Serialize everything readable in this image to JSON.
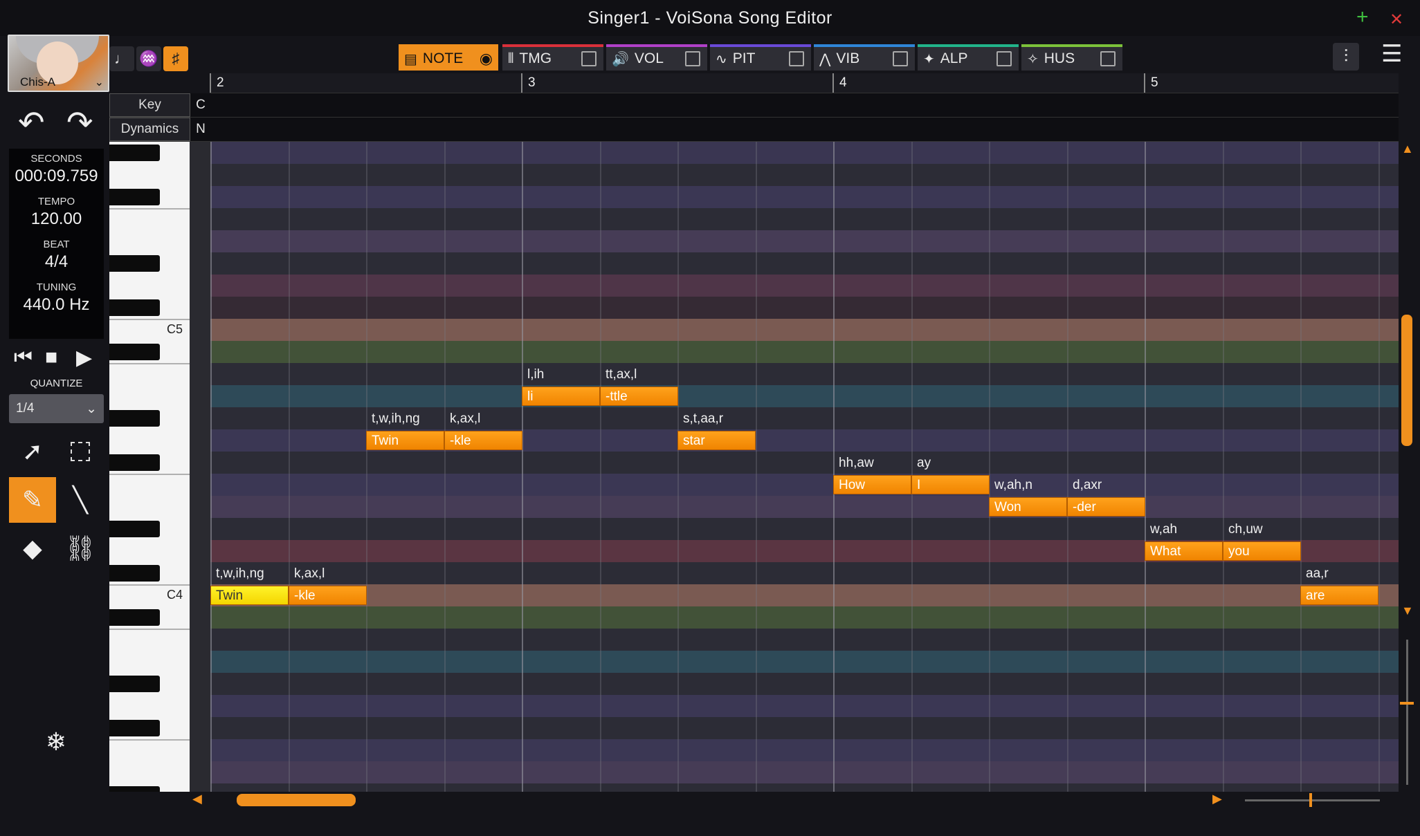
{
  "window": {
    "title": "Singer1 - VoiSona Song Editor",
    "add_symbol": "+",
    "close_symbol": "✕"
  },
  "singer": {
    "name": "Chis-A",
    "chevron": "⌄"
  },
  "info": {
    "seconds_label": "SECONDS",
    "seconds": "000:09.759",
    "tempo_label": "TEMPO",
    "tempo": "120.00",
    "beat_label": "BEAT",
    "beat": "4/4",
    "tuning_label": "TUNING",
    "tuning": "440.0 Hz"
  },
  "quantize": {
    "label": "QUANTIZE",
    "value": "1/4"
  },
  "tabs": [
    {
      "label": "NOTE",
      "color": "#f0901e"
    },
    {
      "label": "TMG",
      "color": "#d9303a"
    },
    {
      "label": "VOL",
      "color": "#b040c8"
    },
    {
      "label": "PIT",
      "color": "#6a4ad8"
    },
    {
      "label": "VIB",
      "color": "#2f86d8"
    },
    {
      "label": "ALP",
      "color": "#22b48a"
    },
    {
      "label": "HUS",
      "color": "#7cc23a"
    }
  ],
  "ruler": {
    "bars": [
      "2",
      "3",
      "4",
      "5"
    ]
  },
  "rows": {
    "key_label": "Key",
    "key_value": "C",
    "dyn_label": "Dynamics",
    "dyn_value": "N"
  },
  "piano": {
    "c5": "C5",
    "c4": "C4"
  },
  "notes": [
    {
      "lyric": "Twin",
      "phonemes": "t,w,ih,ng",
      "selected": true
    },
    {
      "lyric": "-kle",
      "phonemes": "k,ax,l"
    },
    {
      "lyric": "Twin",
      "phonemes": "t,w,ih,ng"
    },
    {
      "lyric": "-kle",
      "phonemes": "k,ax,l"
    },
    {
      "lyric": "li",
      "phonemes": "l,ih"
    },
    {
      "lyric": "-ttle",
      "phonemes": "tt,ax,l"
    },
    {
      "lyric": "star",
      "phonemes": "s,t,aa,r"
    },
    {
      "lyric": "How",
      "phonemes": "hh,aw"
    },
    {
      "lyric": "I",
      "phonemes": "ay"
    },
    {
      "lyric": "Won",
      "phonemes": "w,ah,n"
    },
    {
      "lyric": "-der",
      "phonemes": "d,axr"
    },
    {
      "lyric": "What",
      "phonemes": "w,ah"
    },
    {
      "lyric": "you",
      "phonemes": "ch,uw"
    },
    {
      "lyric": "are",
      "phonemes": "aa,r"
    }
  ],
  "accent": "#f0901e"
}
